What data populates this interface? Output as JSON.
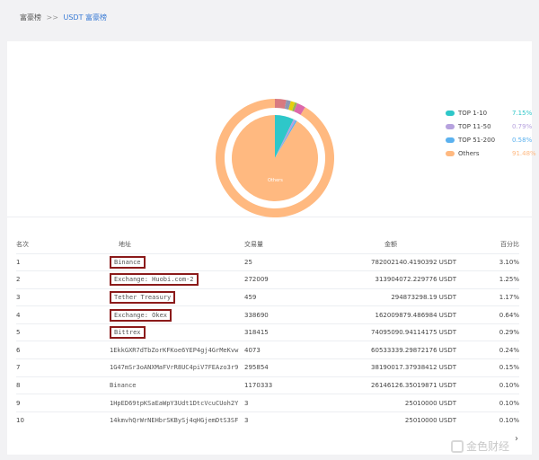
{
  "breadcrumb": {
    "root": "富豪榜",
    "sep": ">>",
    "current": "USDT 富豪榜"
  },
  "chart_data": {
    "type": "pie",
    "slices": [
      {
        "label": "TOP 1-10",
        "value": 7.15,
        "color": "#2ec7c9"
      },
      {
        "label": "TOP 11-50",
        "value": 0.79,
        "color": "#b6a2de"
      },
      {
        "label": "TOP 51-200",
        "value": 0.58,
        "color": "#5ab1ef"
      },
      {
        "label": "Others",
        "value": 91.48,
        "color": "#ffb980"
      }
    ],
    "legend_values": [
      "7.15%",
      "0.79%",
      "0.58%",
      "91.48%"
    ],
    "legend_position": "right",
    "inner_label": "Others",
    "outer_ring": [
      {
        "value": 91.48,
        "color": "#ffb980"
      },
      {
        "value": 3.1,
        "color": "#d87a80"
      },
      {
        "value": 1.25,
        "color": "#8d98b3"
      },
      {
        "value": 1.17,
        "color": "#e5cf0d"
      },
      {
        "value": 0.64,
        "color": "#97b552"
      },
      {
        "value": 2.36,
        "color": "#dc69aa"
      }
    ]
  },
  "table": {
    "headers": {
      "rank": "名次",
      "address": "地址",
      "tx": "交易量",
      "amount": "金额",
      "pct": "百分比"
    },
    "rows": [
      {
        "rank": "1",
        "address": "Binance",
        "tx": "25",
        "amount": "782002140.4190392 USDT",
        "pct": "3.10%",
        "highlight": true
      },
      {
        "rank": "2",
        "address": "Exchange: Huobi.com-2",
        "tx": "272009",
        "amount": "313904072.229776 USDT",
        "pct": "1.25%",
        "highlight": true
      },
      {
        "rank": "3",
        "address": "Tether Treasury",
        "tx": "459",
        "amount": "294873298.19 USDT",
        "pct": "1.17%",
        "highlight": true
      },
      {
        "rank": "4",
        "address": "Exchange: Okex",
        "tx": "338690",
        "amount": "162009879.486984 USDT",
        "pct": "0.64%",
        "highlight": true
      },
      {
        "rank": "5",
        "address": "Bittrex",
        "tx": "318415",
        "amount": "74095090.94114175 USDT",
        "pct": "0.29%",
        "highlight": true
      },
      {
        "rank": "6",
        "address": "1EkkGXR7dTbZorKFKoe6YEP4gj4GrMeKvw",
        "tx": "4073",
        "amount": "60533339.29872176 USDT",
        "pct": "0.24%",
        "highlight": false
      },
      {
        "rank": "7",
        "address": "1G47mSr3oANXMaFVrR8UC4piV7FEAzo3r9",
        "tx": "295854",
        "amount": "38190017.37938412 USDT",
        "pct": "0.15%",
        "highlight": false
      },
      {
        "rank": "8",
        "address": "Binance",
        "tx": "1170333",
        "amount": "26146126.35019871 USDT",
        "pct": "0.10%",
        "highlight": false
      },
      {
        "rank": "9",
        "address": "1HpED69tpKSaEaWpY3Udt1DtcVcuCUoh2Y",
        "tx": "3",
        "amount": "25010000 USDT",
        "pct": "0.10%",
        "highlight": false
      },
      {
        "rank": "10",
        "address": "14kmvhQrWrNEHbrSKBySj4qHGjemDtS3SF",
        "tx": "3",
        "amount": "25010000 USDT",
        "pct": "0.10%",
        "highlight": false
      }
    ]
  },
  "pagination": {
    "next": "›"
  },
  "watermark": "金色财经"
}
